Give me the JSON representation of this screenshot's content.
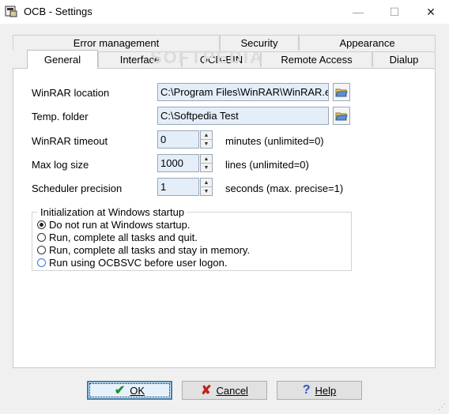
{
  "window": {
    "title": "OCB - Settings"
  },
  "titlebar": {
    "min": "—",
    "max": "☐",
    "close": "✕"
  },
  "watermark": "SOFTPEDIA",
  "tabs": {
    "back": [
      "Error management",
      "Security",
      "Appearance"
    ],
    "front": [
      "General",
      "Interface",
      "OCB-BIN",
      "Remote Access",
      "Dialup"
    ],
    "active": "General"
  },
  "general": {
    "winrar_location": {
      "label": "WinRAR location",
      "value": "C:\\Program Files\\WinRAR\\WinRAR.exe"
    },
    "temp_folder": {
      "label": "Temp. folder",
      "value": "C:\\Softpedia Test"
    },
    "winrar_timeout": {
      "label": "WinRAR timeout",
      "value": "0",
      "unit": "minutes (unlimited=0)"
    },
    "max_log_size": {
      "label": "Max log size",
      "value": "1000",
      "unit": "lines (unlimited=0)"
    },
    "scheduler_precision": {
      "label": "Scheduler precision",
      "value": "1",
      "unit": "seconds (max. precise=1)"
    }
  },
  "startup": {
    "title": "Initialization at Windows startup",
    "options": [
      {
        "label": "Do not run at Windows startup.",
        "selected": true
      },
      {
        "label": "Run, complete all tasks and quit.",
        "selected": false
      },
      {
        "label": "Run, complete all tasks and stay in memory.",
        "selected": false
      },
      {
        "label": "Run using OCBSVC before user logon.",
        "selected": false
      }
    ]
  },
  "buttons": {
    "ok": "OK",
    "cancel": "Cancel",
    "help": "Help"
  },
  "colors": {
    "field_bg": "#e4eef9",
    "ok_icon": "#1f8f2a",
    "cancel_icon": "#c0241c",
    "help_icon": "#2a58c2"
  }
}
